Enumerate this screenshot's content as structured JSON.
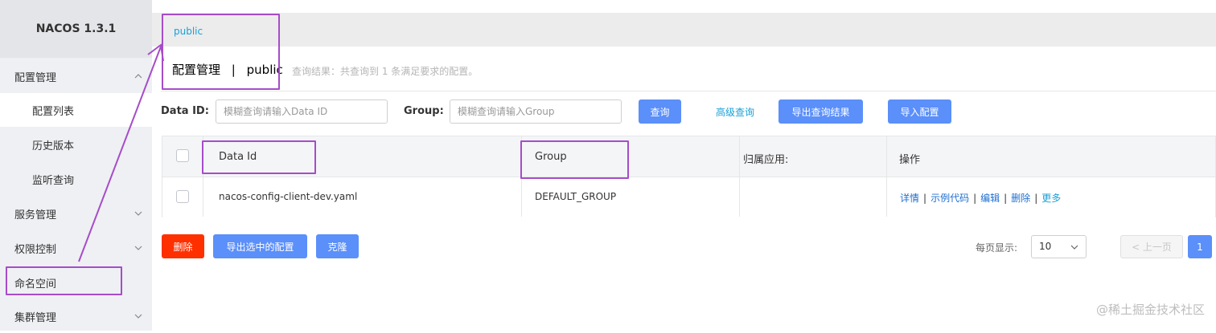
{
  "app": {
    "title": "NACOS 1.3.1"
  },
  "sidebar": {
    "items": [
      {
        "label": "配置管理"
      },
      {
        "label": "配置列表"
      },
      {
        "label": "历史版本"
      },
      {
        "label": "监听查询"
      },
      {
        "label": "服务管理"
      },
      {
        "label": "权限控制"
      },
      {
        "label": "命名空间"
      },
      {
        "label": "集群管理"
      }
    ]
  },
  "namespace": {
    "current": "public"
  },
  "page": {
    "title": "配置管理",
    "separator": "|",
    "namespace": "public",
    "result_text": "查询结果：共查询到 1 条满足要求的配置。"
  },
  "search": {
    "data_id_label": "Data ID:",
    "data_id_placeholder": "模糊查询请输入Data ID",
    "group_label": "Group:",
    "group_placeholder": "模糊查询请输入Group",
    "query_button": "查询",
    "advanced_link": "高级查询",
    "export_button": "导出查询结果",
    "import_button": "导入配置"
  },
  "table": {
    "headers": [
      "Data Id",
      "Group",
      "归属应用:",
      "操作"
    ],
    "rows": [
      {
        "data_id": "nacos-config-client-dev.yaml",
        "group": "DEFAULT_GROUP",
        "app": ""
      }
    ],
    "actions": [
      "详情",
      "示例代码",
      "编辑",
      "删除",
      "更多"
    ],
    "action_separator": "|"
  },
  "bulk": {
    "delete_button": "删除",
    "export_selected_button": "导出选中的配置",
    "clone_button": "克隆"
  },
  "pagination": {
    "page_size_label": "每页显示:",
    "page_size": "10",
    "prev_label": "< 上一页",
    "current_page": "1"
  },
  "watermark": {
    "text": "@稀土掘金技术社区"
  },
  "colors": {
    "primary": "#5b8ff9",
    "danger": "#ff3000",
    "link": "#1aa0d6",
    "annotation": "#a64cc9"
  }
}
